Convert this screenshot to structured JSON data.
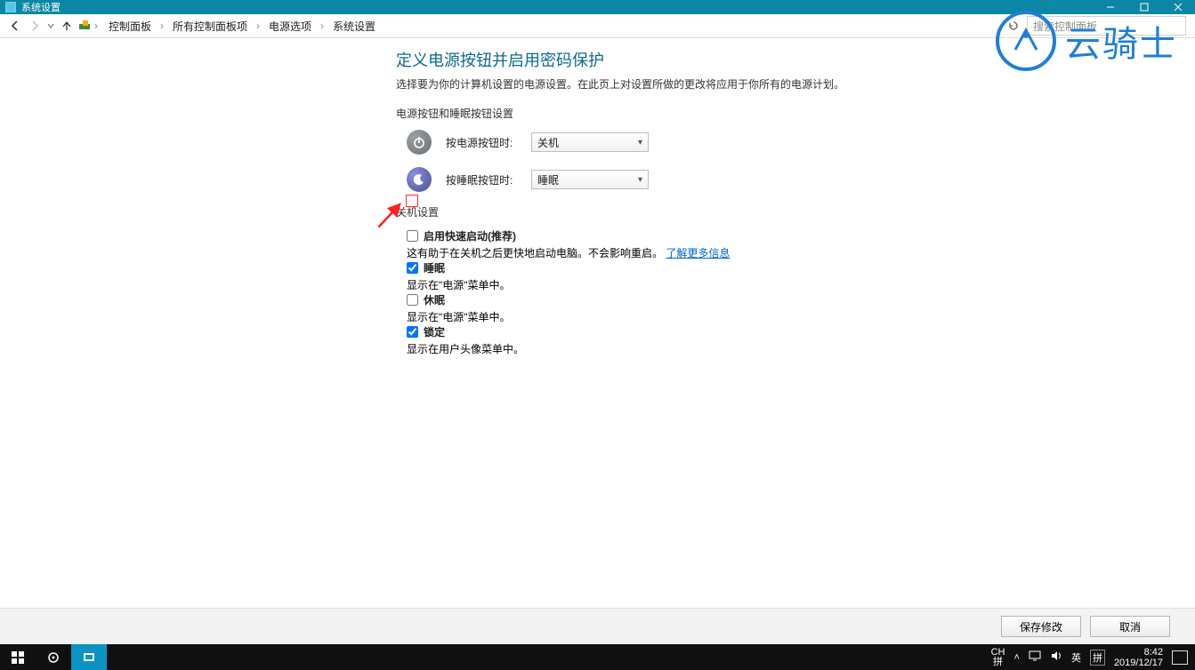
{
  "titlebar": {
    "title": "系统设置"
  },
  "breadcrumb": {
    "parts": [
      "控制面板",
      "所有控制面板项",
      "电源选项",
      "系统设置"
    ]
  },
  "search": {
    "placeholder": "搜索控制面板"
  },
  "page": {
    "heading": "定义电源按钮并启用密码保护",
    "subtitle": "选择要为你的计算机设置的电源设置。在此页上对设置所做的更改将应用于你所有的电源计划。",
    "section_buttons": "电源按钮和睡眠按钮设置",
    "row_power": {
      "label": "按电源按钮时:",
      "value": "关机"
    },
    "row_sleep": {
      "label": "按睡眠按钮时:",
      "value": "睡眠"
    },
    "section_shutdown": "关机设置",
    "options": {
      "fast": {
        "label": "启用快速启动(推荐)",
        "desc": "这有助于在关机之后更快地启动电脑。不会影响重启。",
        "link": "了解更多信息",
        "checked": false
      },
      "sleep": {
        "label": "睡眠",
        "desc": "显示在\"电源\"菜单中。",
        "checked": true
      },
      "hibernate": {
        "label": "休眠",
        "desc": "显示在\"电源\"菜单中。",
        "checked": false
      },
      "lock": {
        "label": "锁定",
        "desc": "显示在用户头像菜单中。",
        "checked": true
      }
    },
    "save": "保存修改",
    "cancel": "取消"
  },
  "watermark": {
    "text": "云骑士"
  },
  "tray": {
    "ime1": "CH",
    "ime2": "拼",
    "lang": "英",
    "kb": "拼",
    "time": "8:42",
    "date": "2019/12/17"
  }
}
